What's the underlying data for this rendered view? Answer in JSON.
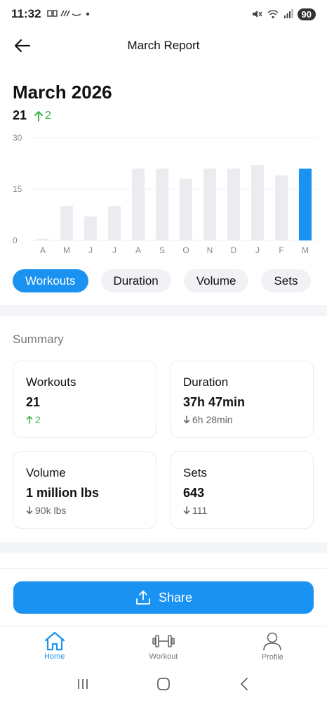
{
  "status_bar": {
    "time": "11:32",
    "left_icons": [
      "notification-icon",
      "signal-icon",
      "cast-icon",
      "dot-icon"
    ],
    "battery": "90"
  },
  "header": {
    "title": "March Report",
    "back_icon": "arrow-left-icon"
  },
  "report": {
    "title": "March 2026",
    "count": "21",
    "delta": "2"
  },
  "chart_data": {
    "type": "bar",
    "categories": [
      "A",
      "M",
      "J",
      "J",
      "A",
      "S",
      "O",
      "N",
      "D",
      "J",
      "F",
      "M"
    ],
    "values": [
      0.5,
      10,
      7,
      10,
      21,
      21,
      18,
      21,
      21,
      22,
      19,
      21
    ],
    "highlight_index": 11,
    "yticks": [
      "30",
      "15",
      "0"
    ],
    "ylim": [
      0,
      30
    ],
    "bar_color": "#ebebf0",
    "highlight_color": "#1a92f2",
    "grid": true
  },
  "metric_tabs": [
    {
      "label": "Workouts",
      "active": true
    },
    {
      "label": "Duration",
      "active": false
    },
    {
      "label": "Volume",
      "active": false
    },
    {
      "label": "Sets",
      "active": false
    }
  ],
  "summary": {
    "label": "Summary",
    "cards": [
      {
        "label": "Workouts",
        "value": "21",
        "delta": "2",
        "direction": "up"
      },
      {
        "label": "Duration",
        "value": "37h 47min",
        "delta": "6h 28min",
        "direction": "down"
      },
      {
        "label": "Volume",
        "value": "1 million lbs",
        "delta": "90k lbs",
        "direction": "down"
      },
      {
        "label": "Sets",
        "value": "643",
        "delta": "111",
        "direction": "down"
      }
    ]
  },
  "share": {
    "label": "Share",
    "icon": "upload-icon"
  },
  "bottom_nav": [
    {
      "label": "Home",
      "icon": "home-icon",
      "active": true
    },
    {
      "label": "Workout",
      "icon": "dumbbell-icon",
      "active": false
    },
    {
      "label": "Profile",
      "icon": "person-icon",
      "active": false
    }
  ],
  "colors": {
    "accent": "#1a92f2",
    "up": "#3bb54a",
    "muted": "#777777"
  }
}
